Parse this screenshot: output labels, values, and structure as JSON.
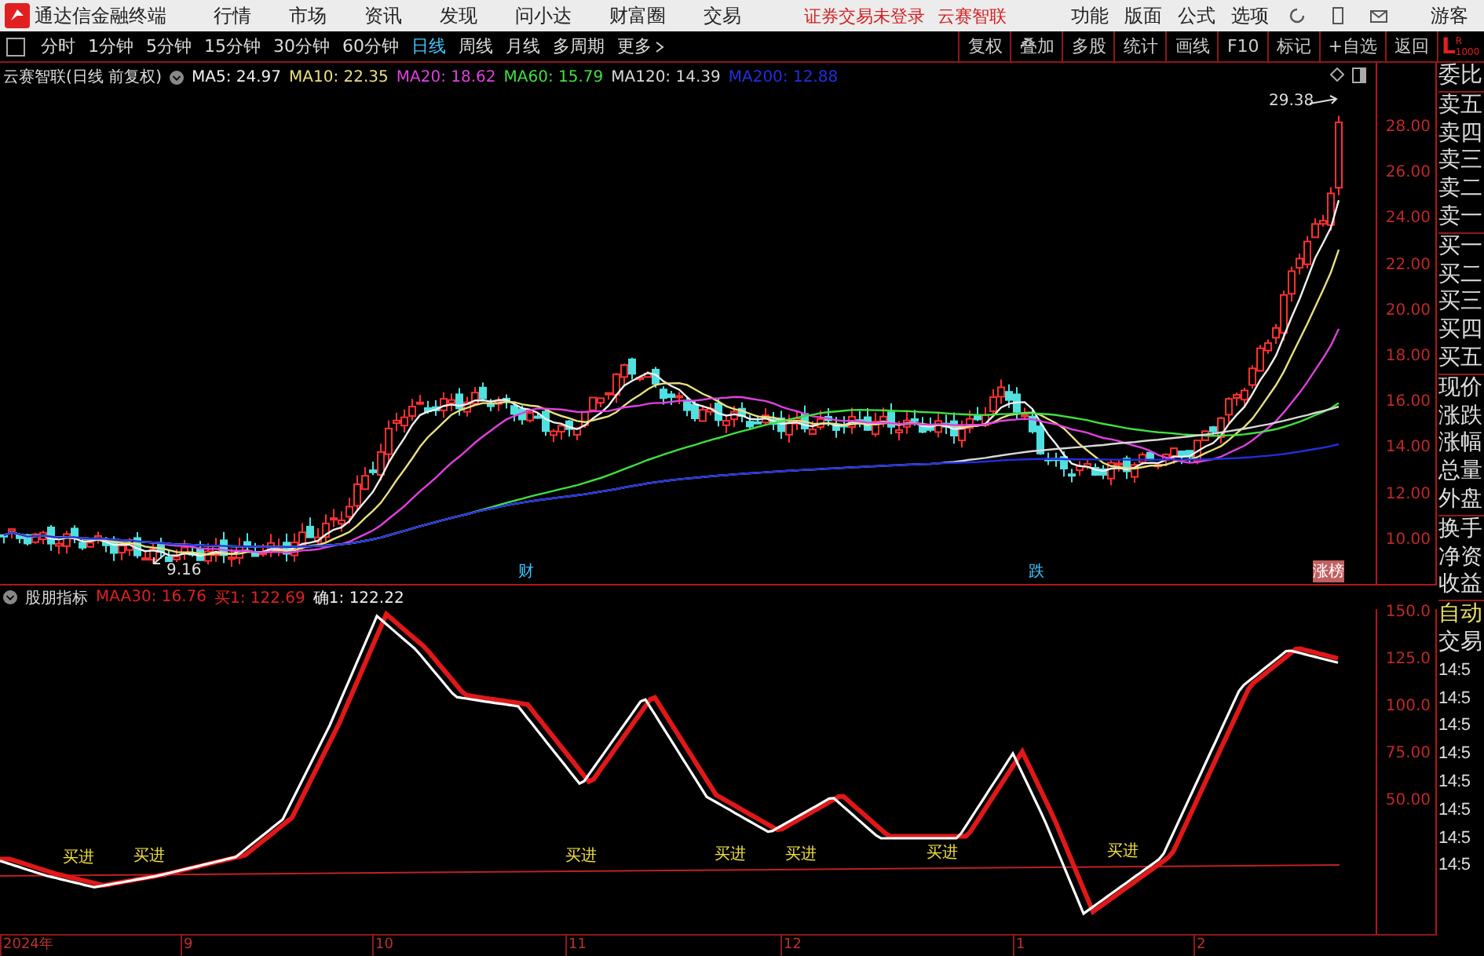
{
  "menubar": {
    "app_title": "通达信金融终端",
    "menus": [
      "行情",
      "市场",
      "资讯",
      "发现",
      "问小达",
      "财富圈",
      "交易"
    ],
    "notices": [
      "证券交易未登录",
      "云赛智联"
    ],
    "right_menus": [
      "功能",
      "版面",
      "公式",
      "选项"
    ],
    "user": "游客"
  },
  "periods": [
    {
      "label": "分时",
      "selected": false
    },
    {
      "label": "1分钟",
      "selected": false
    },
    {
      "label": "5分钟",
      "selected": false
    },
    {
      "label": "15分钟",
      "selected": false
    },
    {
      "label": "30分钟",
      "selected": false
    },
    {
      "label": "60分钟",
      "selected": false
    },
    {
      "label": "日线",
      "selected": true
    },
    {
      "label": "周线",
      "selected": false
    },
    {
      "label": "月线",
      "selected": false
    },
    {
      "label": "多周期",
      "selected": false
    },
    {
      "label": "更多",
      "selected": false
    }
  ],
  "tool_buttons": [
    "复权",
    "叠加",
    "多股",
    "统计",
    "画线",
    "F10",
    "标记",
    "+自选",
    "返回"
  ],
  "corner": {
    "left": "L",
    "right": "R",
    "sub": "1000"
  },
  "main_chart": {
    "title": "云赛智联(日线 前复权)",
    "ma_legend": [
      {
        "text": "MA5: 24.97",
        "color": "#f0f0f0"
      },
      {
        "text": "MA10: 22.35",
        "color": "#e8e080"
      },
      {
        "text": "MA20: 18.62",
        "color": "#e040e0"
      },
      {
        "text": "MA60: 15.79",
        "color": "#40e040"
      },
      {
        "text": "MA120: 14.39",
        "color": "#d8d8d8"
      },
      {
        "text": "MA200: 12.88",
        "color": "#2030e0"
      }
    ],
    "high_label": "29.38",
    "low_label": "9.16",
    "markers": [
      {
        "text": "财",
        "kind": "plain"
      },
      {
        "text": "跌",
        "kind": "plain"
      },
      {
        "text": "涨榜",
        "kind": "tag"
      }
    ],
    "price_ticks": [
      "28.00",
      "26.00",
      "24.00",
      "22.00",
      "20.00",
      "18.00",
      "16.00",
      "14.00",
      "12.00",
      "10.00"
    ]
  },
  "indicator": {
    "name": "股朋指标",
    "values": [
      {
        "text": "MAA30: 16.76",
        "color": "#e02020"
      },
      {
        "text": "买1: 122.69",
        "color": "#e02020"
      },
      {
        "text": "确1: 122.22",
        "color": "#f0f0f0"
      }
    ],
    "signals": [
      "买进",
      "买进",
      "买进",
      "买进",
      "买进",
      "买进",
      "买进"
    ],
    "ticks": [
      "150.0",
      "125.0",
      "100.0",
      "75.00",
      "50.00"
    ]
  },
  "quote_labels": [
    "委比",
    "卖五",
    "卖四",
    "卖三",
    "卖二",
    "卖一",
    "买一",
    "买二",
    "买三",
    "买四",
    "买五",
    "现价",
    "涨跌",
    "涨幅",
    "总量",
    "外盘",
    "换手",
    "净资",
    "收益"
  ],
  "trade_panel": {
    "auto": "自动",
    "title": "交易",
    "times": [
      "14:5",
      "14:5",
      "14:5",
      "14:5",
      "14:5",
      "14:5",
      "14:5",
      "14:5"
    ]
  },
  "date_axis": [
    "2024年",
    "9",
    "10",
    "11",
    "12",
    "1",
    "2"
  ]
}
